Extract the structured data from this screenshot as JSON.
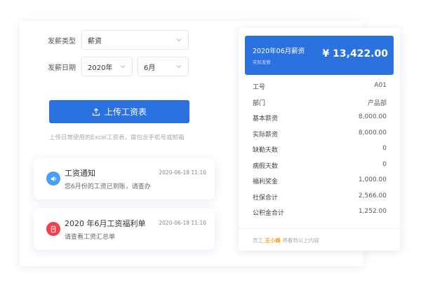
{
  "form": {
    "type_label": "发薪类型",
    "type_value": "薪资",
    "date_label": "发薪日期",
    "year_value": "2020年",
    "month_value": "6月"
  },
  "upload": {
    "button_label": "上传工资表",
    "hint": "上传日常使用的Excel工资表，需包含手机号或邮箱"
  },
  "notifications": [
    {
      "title": "工资通知",
      "time": "2020-06-18 11:10",
      "desc": "您6月份的工资已到账，请查办",
      "color": "#4a9ff5"
    },
    {
      "title": "2020 年6月工资福利单",
      "time": "2020-06-18 11:10",
      "desc": "请查看工资汇总单",
      "color": "#f0414b"
    }
  ],
  "slip": {
    "period": "2020年06月薪资",
    "sub": "实际发薪",
    "amount": "¥ 13,422.00",
    "rows": [
      {
        "label": "工号",
        "value": "A01"
      },
      {
        "label": "部门",
        "value": "产品部"
      },
      {
        "label": "基本薪资",
        "value": "8,000.00"
      },
      {
        "label": "实际薪资",
        "value": "8,000.00"
      },
      {
        "label": "缺勤天数",
        "value": "0"
      },
      {
        "label": "病假天数",
        "value": "0"
      },
      {
        "label": "福利奖金",
        "value": "1,000.00"
      },
      {
        "label": "社保合计",
        "value": "2,566.00"
      },
      {
        "label": "公积金合计",
        "value": "1,252.00"
      }
    ],
    "footer_prefix": "员工",
    "footer_name": "王小峰",
    "footer_suffix": "将看到以上内容"
  },
  "colors": {
    "accent": "#2c71e0",
    "highlight": "#f5a623"
  }
}
